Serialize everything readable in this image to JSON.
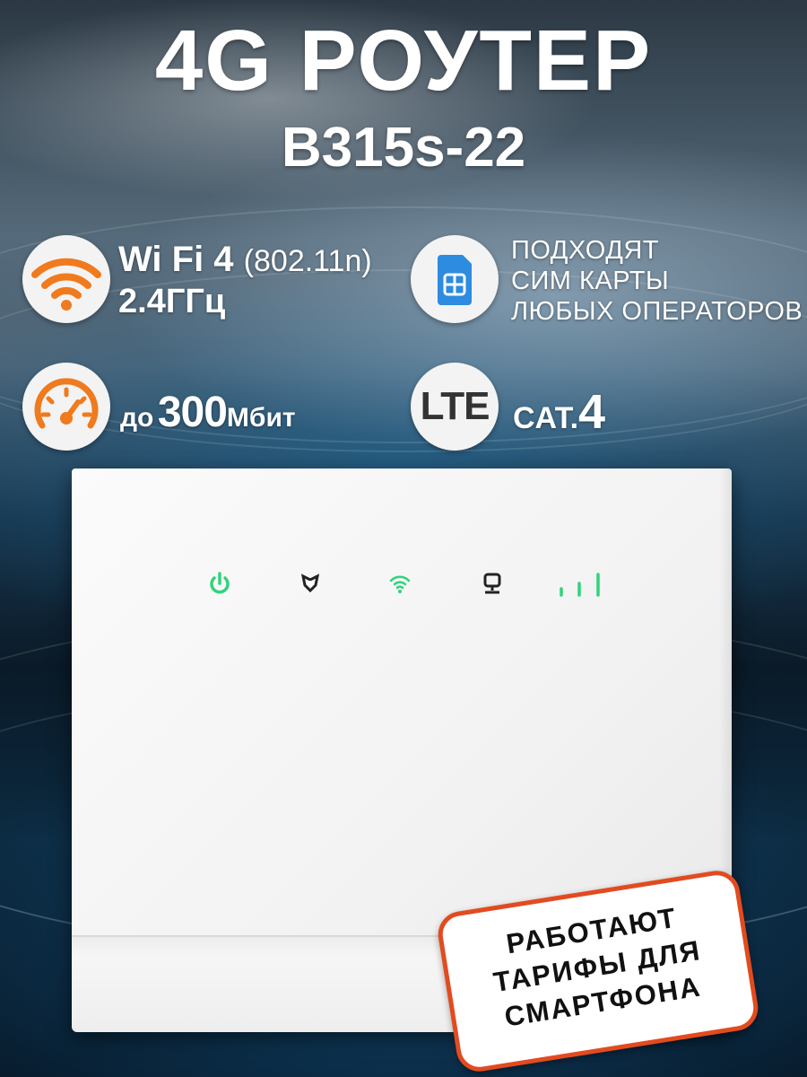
{
  "header": {
    "title": "4G РОУТЕР",
    "model": "B315s-22"
  },
  "features": {
    "wifi": {
      "icon": "wifi-icon",
      "name": "Wi Fi 4",
      "standard": "(802.11n)",
      "band": "2.4ГГц"
    },
    "sim": {
      "icon": "sim-card-icon",
      "line1": "ПОДХОДЯТ",
      "line2": "СИМ КАРТЫ",
      "line3": "ЛЮБЫХ ОПЕРАТОРОВ"
    },
    "speed": {
      "icon": "speedometer-icon",
      "prefix": "до",
      "value": "300",
      "unit": "Мбит"
    },
    "lte": {
      "badge": "LTE",
      "cat_label": "CAT.",
      "cat_value": "4"
    }
  },
  "router": {
    "leds": [
      "power-icon",
      "network-icon",
      "wifi-icon",
      "lan-icon",
      "signal-icon"
    ],
    "led_color": "#2fd47a"
  },
  "badge": {
    "line1": "РАБОТАЮТ",
    "line2": "ТАРИФЫ ДЛЯ",
    "line3": "СМАРТФОНА",
    "border_color": "#e24b1f"
  },
  "colors": {
    "accent_orange": "#f07a1e",
    "sim_blue": "#2d8be0"
  }
}
